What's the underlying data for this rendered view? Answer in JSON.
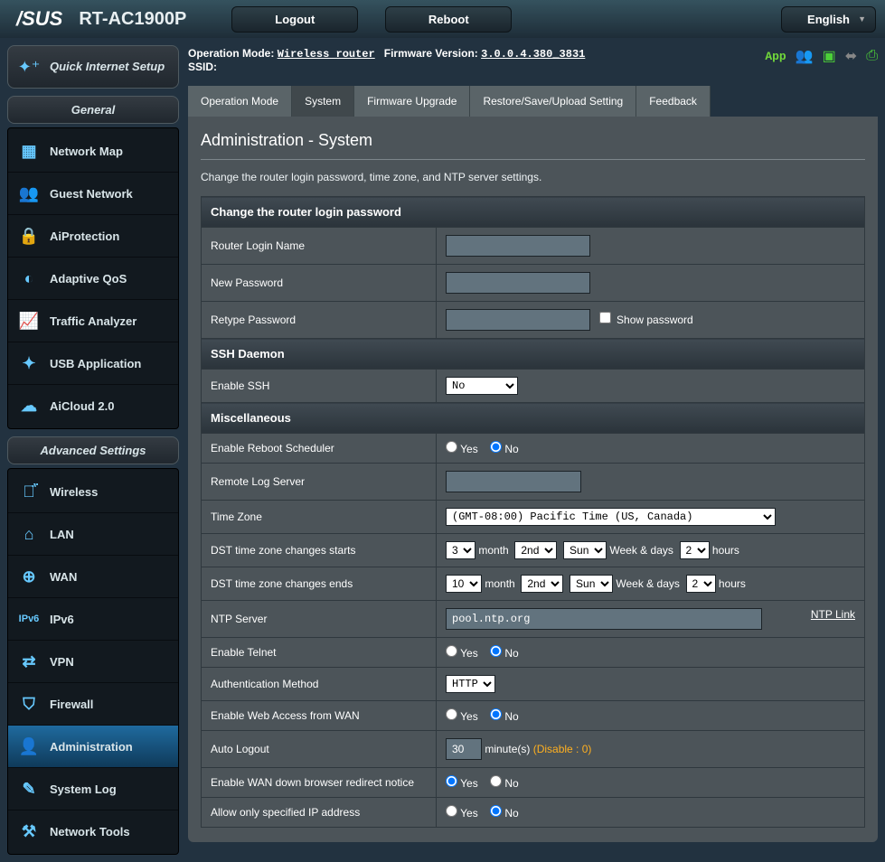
{
  "header": {
    "brand": "/SUS",
    "model": "RT-AC1900P",
    "logout": "Logout",
    "reboot": "Reboot",
    "language": "English"
  },
  "quick_setup": "Quick Internet Setup",
  "section_general": "General",
  "section_advanced": "Advanced Settings",
  "nav_general": [
    "Network Map",
    "Guest Network",
    "AiProtection",
    "Adaptive QoS",
    "Traffic Analyzer",
    "USB Application",
    "AiCloud 2.0"
  ],
  "nav_advanced": [
    "Wireless",
    "LAN",
    "WAN",
    "IPv6",
    "VPN",
    "Firewall",
    "Administration",
    "System Log",
    "Network Tools"
  ],
  "info": {
    "opmode_label": "Operation Mode:",
    "opmode_value": "Wireless router",
    "fw_label": "Firmware Version:",
    "fw_value": "3.0.0.4.380_3831",
    "ssid_label": "SSID:",
    "ssid_value": "",
    "app": "App"
  },
  "tabs": [
    "Operation Mode",
    "System",
    "Firmware Upgrade",
    "Restore/Save/Upload Setting",
    "Feedback"
  ],
  "page": {
    "title": "Administration - System",
    "desc": "Change the router login password, time zone, and NTP server settings."
  },
  "sec_login": {
    "head": "Change the router login password",
    "login_name": "Router Login Name",
    "new_pw": "New Password",
    "retype_pw": "Retype Password",
    "show_pw": "Show password"
  },
  "sec_ssh": {
    "head": "SSH Daemon",
    "enable": "Enable SSH",
    "value": "No"
  },
  "sec_misc": {
    "head": "Miscellaneous",
    "reboot_sched": "Enable Reboot Scheduler",
    "remote_log": "Remote Log Server",
    "timezone": "Time Zone",
    "timezone_val": "(GMT-08:00) Pacific Time (US, Canada)",
    "dst_start": "DST time zone changes starts",
    "dst_end": "DST time zone changes ends",
    "dst_month": "month",
    "dst_weekdays": "Week & days",
    "dst_hours": "hours",
    "dst_start_m": "3",
    "dst_start_w": "2nd",
    "dst_start_d": "Sun",
    "dst_start_h": "2",
    "dst_end_m": "10",
    "dst_end_w": "2nd",
    "dst_end_d": "Sun",
    "dst_end_h": "2",
    "ntp": "NTP Server",
    "ntp_val": "pool.ntp.org",
    "ntp_link": "NTP Link",
    "telnet": "Enable Telnet",
    "auth": "Authentication Method",
    "auth_val": "HTTP",
    "wan_access": "Enable Web Access from WAN",
    "auto_logout": "Auto Logout",
    "auto_logout_val": "30",
    "auto_logout_unit": "minute(s)",
    "auto_logout_note": "(Disable : 0)",
    "wan_down": "Enable WAN down browser redirect notice",
    "specified_ip": "Allow only specified IP address",
    "yes": "Yes",
    "no": "No"
  }
}
